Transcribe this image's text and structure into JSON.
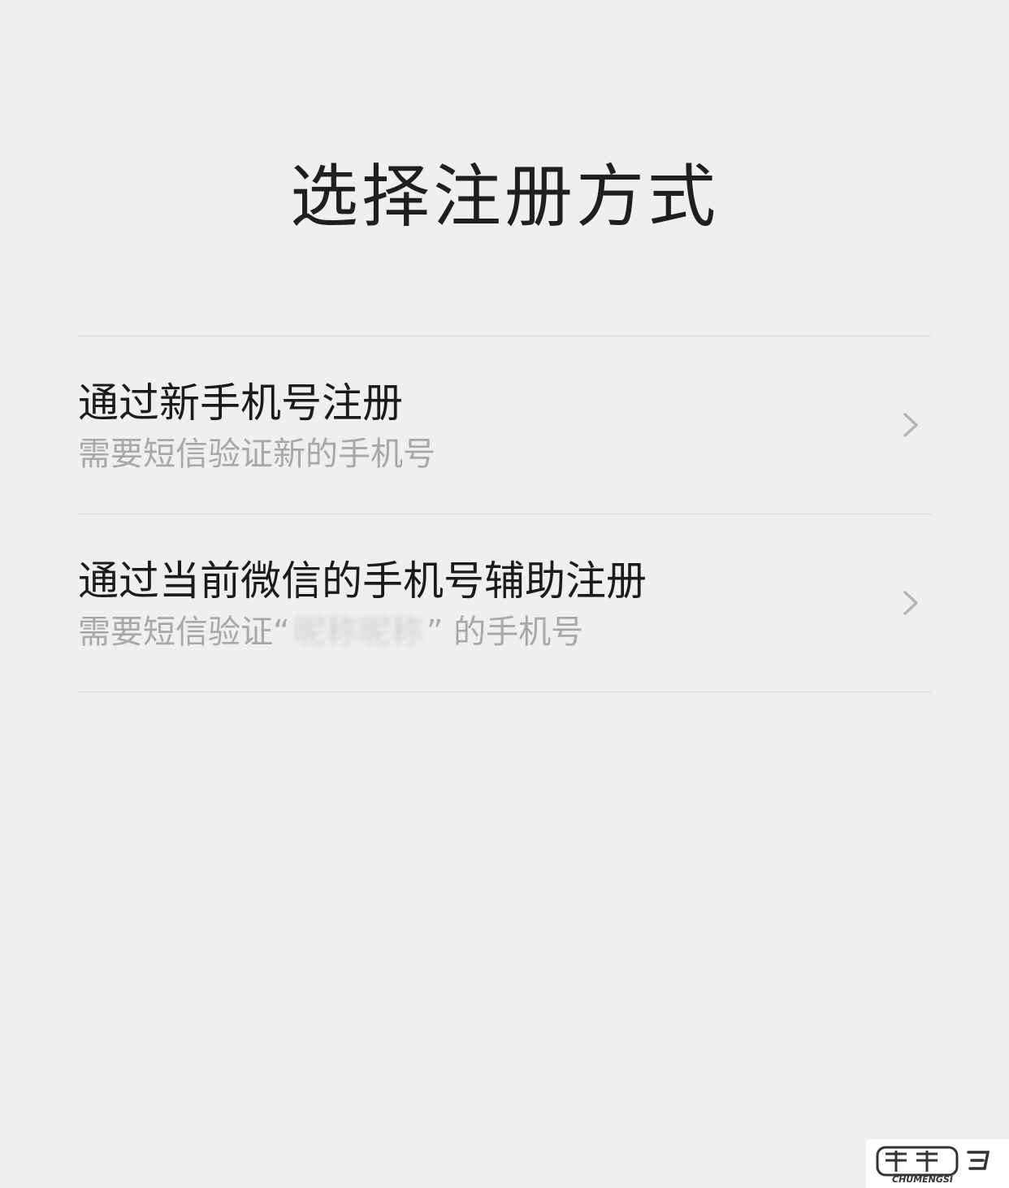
{
  "page": {
    "title": "选择注册方式"
  },
  "options": [
    {
      "title": "通过新手机号注册",
      "desc": "需要短信验证新的手机号"
    },
    {
      "title": "通过当前微信的手机号辅助注册",
      "desc_prefix": "需要短信验证",
      "desc_open_quote": "“",
      "desc_masked": "昵称昵称",
      "desc_close_quote": "”",
      "desc_suffix": " 的手机号"
    }
  ],
  "icons": {
    "chevron": "chevron-right-icon"
  },
  "colors": {
    "background": "#efefef",
    "title": "#1f1f1f",
    "desc": "#a8a8a8",
    "divider": "#d9d9d9"
  },
  "watermark": {
    "brand_text": "CHUMENGSI"
  }
}
